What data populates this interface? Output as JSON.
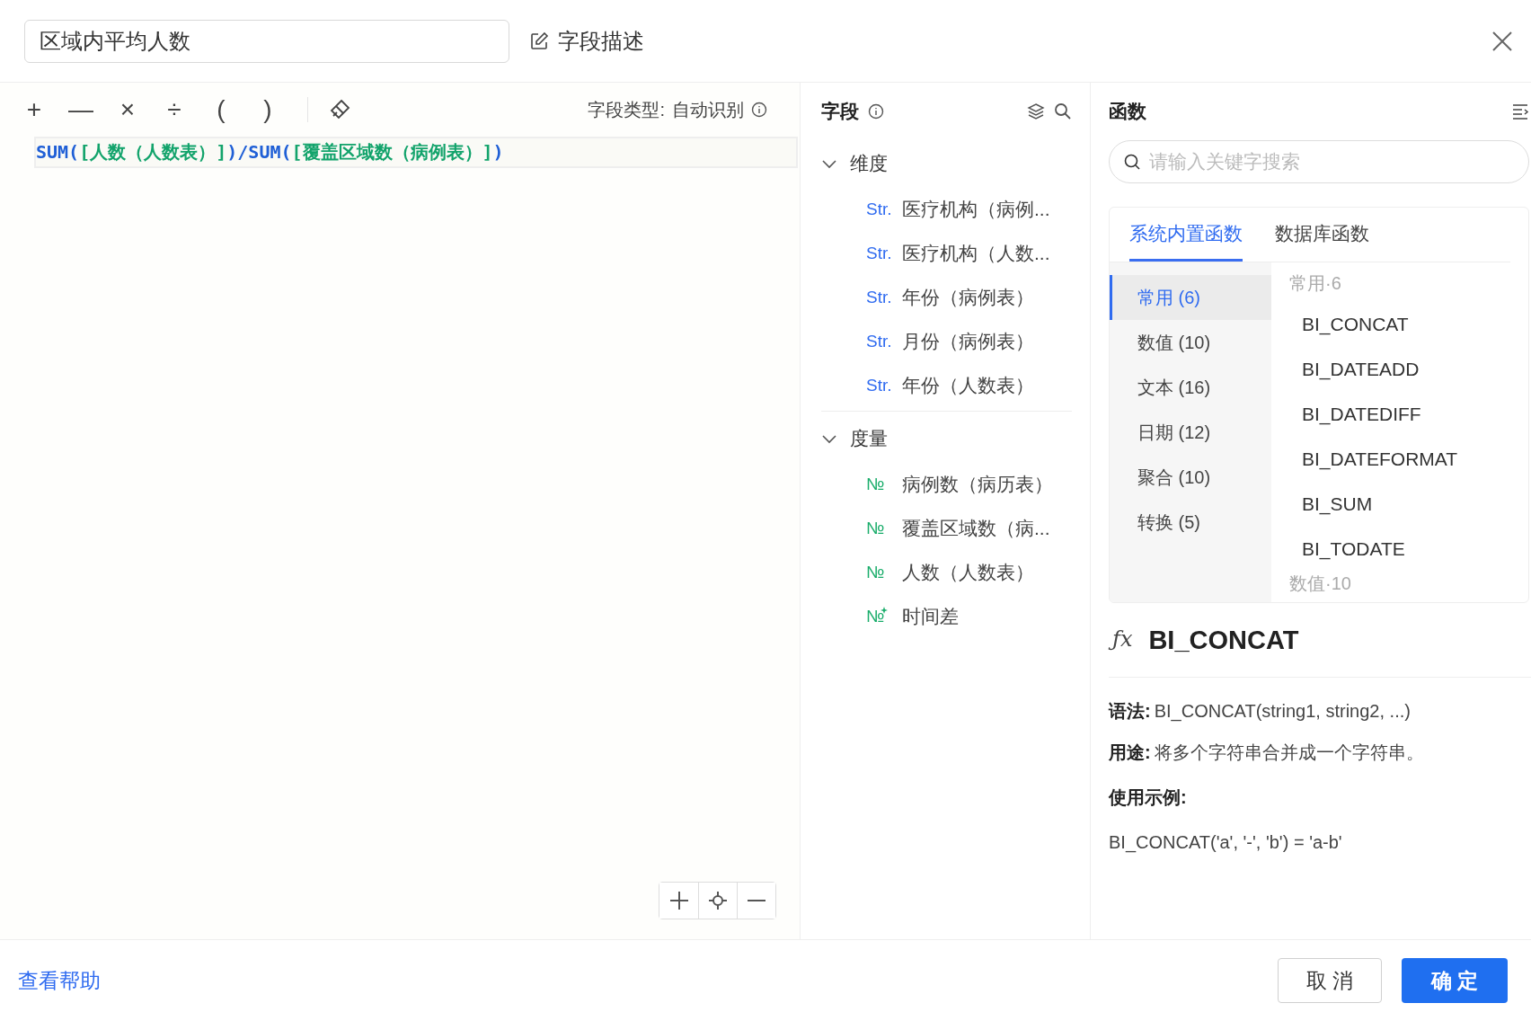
{
  "header": {
    "name_value": "区域内平均人数",
    "description_button": "字段描述"
  },
  "toolbar": {
    "operators": [
      "+",
      "—",
      "×",
      "÷",
      "(",
      ")"
    ],
    "field_type_label": "字段类型:",
    "field_type_value": "自动识别"
  },
  "formula": [
    {
      "kind": "func",
      "text": "SUM("
    },
    {
      "kind": "field",
      "text": "[人数（人数表）]"
    },
    {
      "kind": "func",
      "text": ")/SUM("
    },
    {
      "kind": "field",
      "text": "[覆盖区域数（病例表）]"
    },
    {
      "kind": "func",
      "text": ")"
    }
  ],
  "fields_panel": {
    "title": "字段",
    "groups": [
      {
        "label": "维度",
        "expanded": true,
        "items": [
          {
            "kind": "string",
            "badge": "Str.",
            "label": "医疗机构（病例..."
          },
          {
            "kind": "string",
            "badge": "Str.",
            "label": "医疗机构（人数..."
          },
          {
            "kind": "string",
            "badge": "Str.",
            "label": "年份（病例表）"
          },
          {
            "kind": "string",
            "badge": "Str.",
            "label": "月份（病例表）"
          },
          {
            "kind": "string",
            "badge": "Str.",
            "label": "年份（人数表）"
          }
        ]
      },
      {
        "label": "度量",
        "expanded": true,
        "items": [
          {
            "kind": "number",
            "badge": "№",
            "label": "病例数（病历表）"
          },
          {
            "kind": "number",
            "badge": "№",
            "label": "覆盖区域数（病..."
          },
          {
            "kind": "number",
            "badge": "№",
            "label": "人数（人数表）"
          },
          {
            "kind": "calculated",
            "badge": "№",
            "label": "时间差"
          }
        ]
      }
    ]
  },
  "functions_panel": {
    "title": "函数",
    "search": {
      "placeholder": "请输入关键字搜索"
    },
    "tabs": [
      {
        "label": "系统内置函数",
        "selected": true
      },
      {
        "label": "数据库函数",
        "selected": false
      }
    ],
    "categories": [
      {
        "label": "常用 (6)",
        "selected": true
      },
      {
        "label": "数值 (10)",
        "selected": false
      },
      {
        "label": "文本 (16)",
        "selected": false
      },
      {
        "label": "日期 (12)",
        "selected": false
      },
      {
        "label": "聚合 (10)",
        "selected": false
      },
      {
        "label": "转换 (5)",
        "selected": false
      }
    ],
    "function_groups": [
      {
        "label": "常用·6",
        "items": [
          "BI_CONCAT",
          "BI_DATEADD",
          "BI_DATEDIFF",
          "BI_DATEFORMAT",
          "BI_SUM",
          "BI_TODATE"
        ]
      },
      {
        "label": "数值·10"
      }
    ],
    "detail": {
      "icon": "ƒx",
      "name": "BI_CONCAT",
      "syntax_label": "语法:",
      "syntax": "BI_CONCAT(string1, string2, ...)",
      "usage_label": "用途:",
      "usage": "将多个字符串合并成一个字符串。",
      "example_label": "使用示例:",
      "example": "BI_CONCAT('a', '-', 'b') = 'a-b'"
    }
  },
  "footer": {
    "help_link": "查看帮助",
    "cancel_button": "取 消",
    "ok_button": "确 定"
  }
}
